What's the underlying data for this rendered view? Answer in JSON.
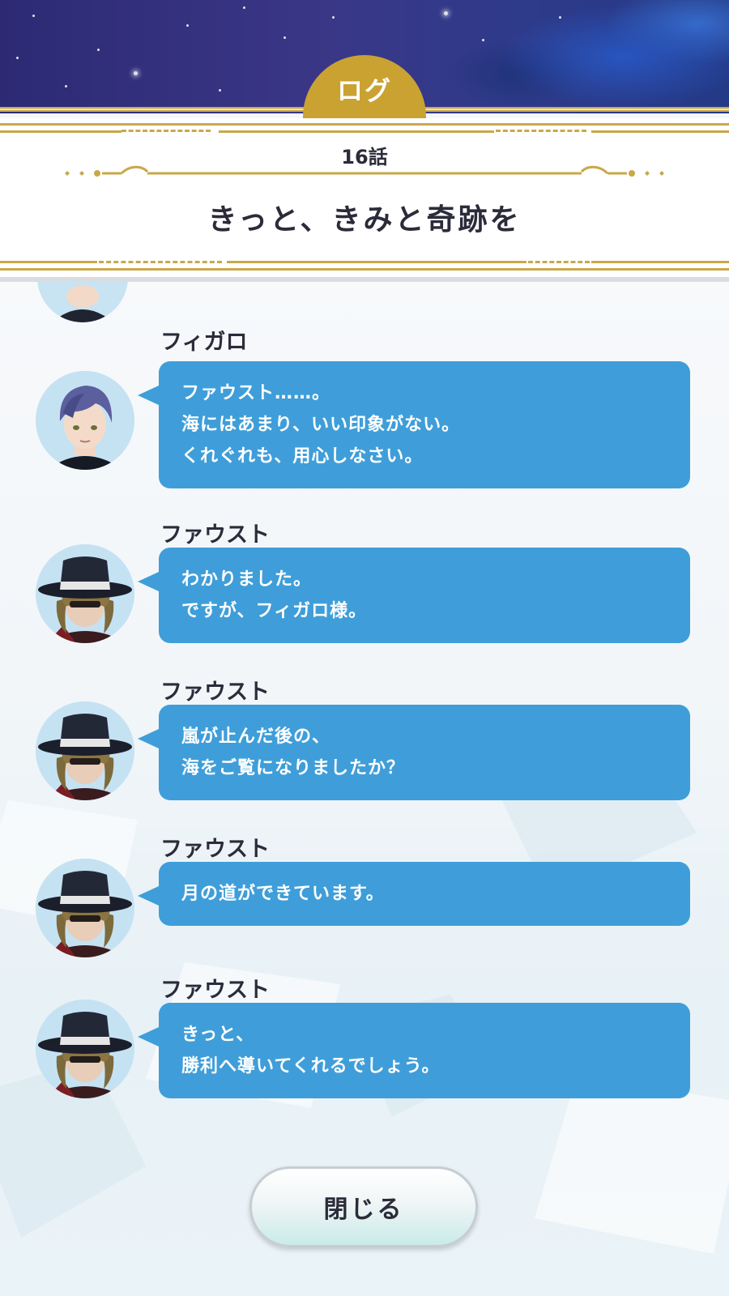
{
  "header": {
    "tab_label": "ログ",
    "episode": "16話",
    "title": "きっと、きみと奇跡を"
  },
  "log": [
    {
      "speaker": "フィガロ",
      "avatar": "figaro-avatar",
      "lines": [
        "ファウスト……。",
        "海にはあまり、いい印象がない。",
        "くれぐれも、用心しなさい。"
      ]
    },
    {
      "speaker": "ファウスト",
      "avatar": "faust-avatar",
      "lines": [
        "わかりました。",
        "ですが、フィガロ様。"
      ]
    },
    {
      "speaker": "ファウスト",
      "avatar": "faust-avatar",
      "lines": [
        "嵐が止んだ後の、",
        "海をご覧になりましたか？"
      ]
    },
    {
      "speaker": "ファウスト",
      "avatar": "faust-avatar",
      "lines": [
        "月の道ができています。"
      ]
    },
    {
      "speaker": "ファウスト",
      "avatar": "faust-avatar",
      "lines": [
        "きっと、",
        "勝利へ導いてくれるでしょう。"
      ]
    }
  ],
  "close_button": {
    "label": "閉じる"
  },
  "colors": {
    "gold": "#c9a84a",
    "bubble": "#3f9ed9",
    "text_dark": "#2b2b3a",
    "avatar_bg": "#c5e2f3"
  }
}
